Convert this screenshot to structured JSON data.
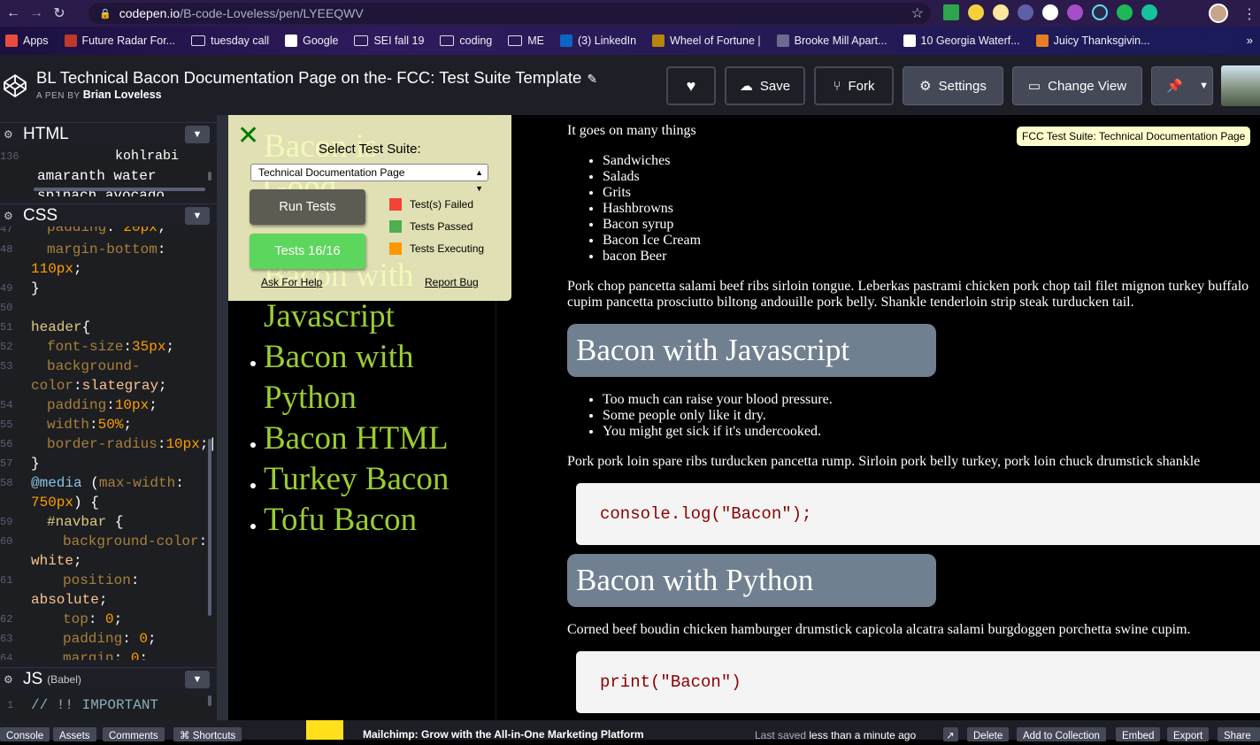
{
  "browser": {
    "url_domain": "codepen.io",
    "url_path": "/B-code-Loveless/pen/LYEEQWV",
    "bookmarks": [
      {
        "label": "Apps",
        "icon": "grid-icon"
      },
      {
        "label": "Future Radar For...",
        "icon": "eye-icon"
      },
      {
        "label": "tuesday call",
        "icon": "folder-icon"
      },
      {
        "label": "Google",
        "icon": "google-icon"
      },
      {
        "label": "SEI fall 19",
        "icon": "folder-icon"
      },
      {
        "label": "coding",
        "icon": "folder-icon"
      },
      {
        "label": "ME",
        "icon": "folder-icon"
      },
      {
        "label": "(3) LinkedIn",
        "icon": "linkedin-icon"
      },
      {
        "label": "Wheel of Fortune |",
        "icon": "wheel-icon"
      },
      {
        "label": "Brooke Mill Apart...",
        "icon": "building-icon"
      },
      {
        "label": "10 Georgia Waterf...",
        "icon": "waterfall-icon"
      },
      {
        "label": "Juicy Thanksgivin...",
        "icon": "food-icon"
      }
    ],
    "bookmarks_more": "»"
  },
  "pen": {
    "title": "BL Technical Bacon Documentation Page on the- FCC: Test Suite Template",
    "by_prefix": "A PEN BY",
    "author": "Brian Loveless",
    "buttons": {
      "save": "Save",
      "fork": "Fork",
      "settings": "Settings",
      "change_view": "Change View"
    }
  },
  "editor": {
    "html_label": "HTML",
    "html_lines": [
      {
        "n": "136",
        "t": "          kohlrabi"
      },
      {
        "n": "",
        "t": "amaranth water"
      },
      {
        "n": "",
        "t": "spinach avocado"
      }
    ],
    "css_label": "CSS",
    "js_label": "JS",
    "js_sub": "(Babel)",
    "js_line": {
      "n": "1",
      "t": "// !! IMPORTANT"
    }
  },
  "preview": {
    "nav_items": [
      "Bacon is Good",
      "Bacon with Javascript",
      "Bacon with",
      "Python",
      "Bacon HTML",
      "Turkey Bacon",
      "Tofu Bacon"
    ],
    "intro": "It goes on many things",
    "uses": [
      "Sandwiches",
      "Salads",
      "Grits",
      "Hashbrowns",
      "Bacon syrup",
      "Bacon Ice Cream",
      "bacon Beer"
    ],
    "p1": "Pork chop pancetta salami beef ribs sirloin tongue. Leberkas pastrami chicken pork chop tail filet mignon turkey buffalo",
    "p1b": "cupim pancetta prosciutto biltong andouille pork belly. Shankle tenderloin strip steak turducken tail.",
    "h_js": "Bacon with Javascript",
    "warnings": [
      "Too much can raise your blood pressure.",
      "Some people only like it dry.",
      "You might get sick if it's undercooked."
    ],
    "p2": "Pork pork loin spare ribs turducken pancetta rump. Sirloin pork belly turkey, pork loin chuck drumstick shankle",
    "code_js": "console.log(\"Bacon\");",
    "h_py": "Bacon with Python",
    "p3": "Corned beef boudin chicken hamburger drumstick capicola alcatra salami burgdoggen porchetta swine cupim.",
    "code_py": "print(\"Bacon\")"
  },
  "fcc": {
    "select_label": "Select Test Suite:",
    "selected": "Technical Documentation Page",
    "run_tests": "Run Tests",
    "tests_result": "Tests 16/16",
    "legend_failed": "Test(s) Failed",
    "legend_passed": "Tests Passed",
    "legend_executing": "Tests Executing",
    "ask_help": "Ask For Help",
    "report_bug": "Report Bug",
    "tooltip": "FCC Test Suite: Technical Documentation Page",
    "colors": {
      "failed": "#f44336",
      "passed": "#4caf50",
      "executing": "#ff9800",
      "run_btn": "#5c5c52",
      "pass_btn": "#5cd65c"
    }
  },
  "footer": {
    "console": "Console",
    "assets": "Assets",
    "comments": "Comments",
    "shortcuts": "⌘ Shortcuts",
    "ad": "Mailchimp: Grow with the All-in-One Marketing Platform",
    "last_saved_prefix": "Last saved",
    "last_saved_value": "less than a minute ago",
    "delete": "Delete",
    "add_collection": "Add to Collection",
    "embed": "Embed",
    "export": "Export",
    "share": "Share"
  }
}
